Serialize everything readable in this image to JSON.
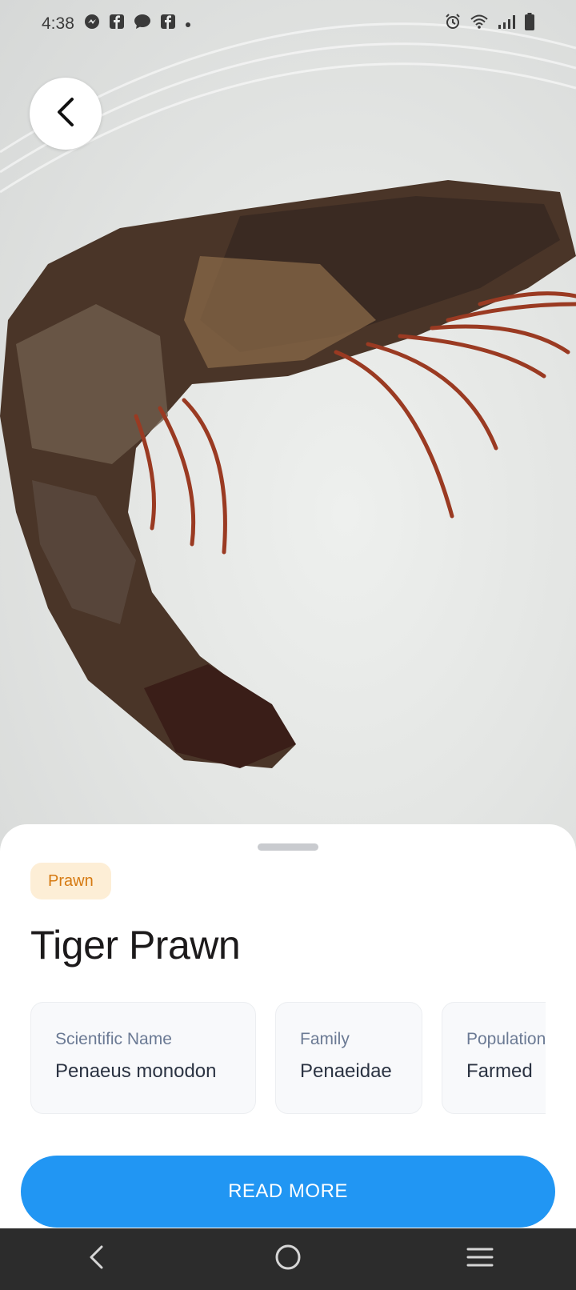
{
  "status_bar": {
    "time": "4:38",
    "left_icons": [
      "messenger-icon",
      "facebook-icon",
      "chat-icon",
      "facebook-icon",
      "dot-icon"
    ],
    "right_icons": [
      "alarm-icon",
      "wifi-icon",
      "signal-icon",
      "battery-icon"
    ]
  },
  "species": {
    "category": "Prawn",
    "name": "Tiger Prawn"
  },
  "info_cards": [
    {
      "label": "Scientific Name",
      "value": "Penaeus monodon"
    },
    {
      "label": "Family",
      "value": "Penaeidae"
    },
    {
      "label": "Population",
      "value": "Farmed"
    }
  ],
  "actions": {
    "read_more_label": "READ MORE"
  },
  "colors": {
    "accent": "#2196f3",
    "badge_bg": "#fdeed6",
    "badge_text": "#d67a12",
    "nav_bar": "#2c2c2c"
  }
}
